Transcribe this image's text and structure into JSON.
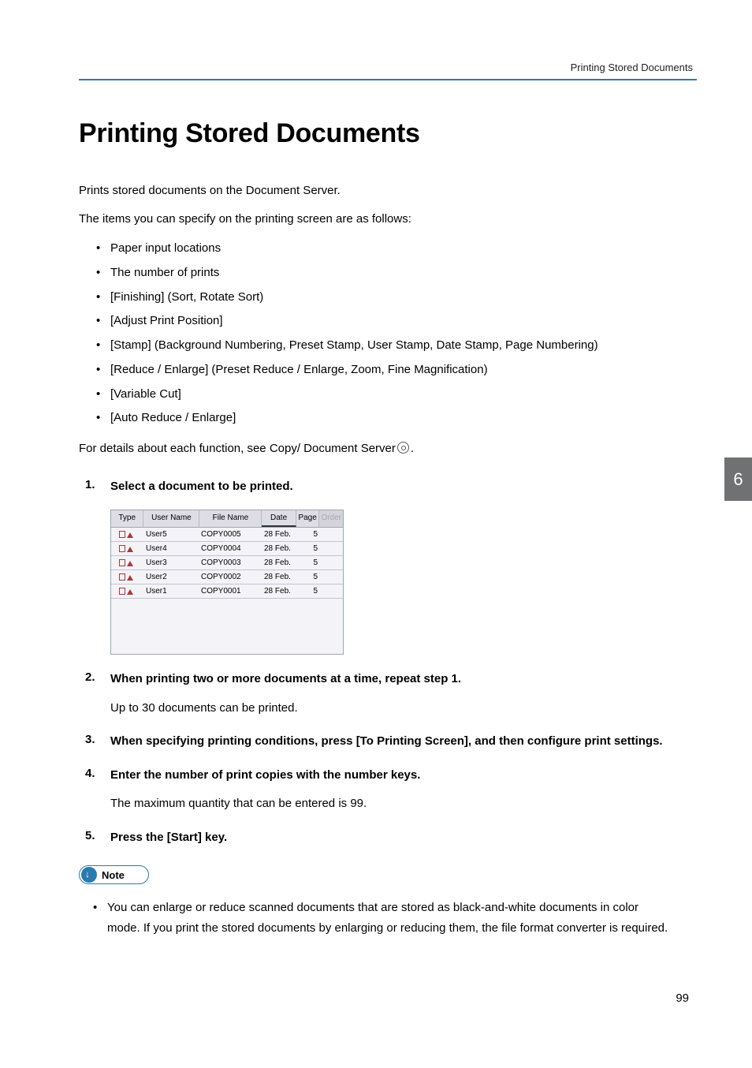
{
  "header": {
    "running_title": "Printing Stored Documents"
  },
  "title": "Printing Stored Documents",
  "intro1": "Prints stored documents on the Document Server.",
  "intro2": "The items you can specify on the printing screen are as follows:",
  "spec_items": [
    "Paper input locations",
    "The number of prints",
    "[Finishing] (Sort, Rotate Sort)",
    "[Adjust Print Position]",
    "[Stamp] (Background Numbering, Preset Stamp, User Stamp, Date Stamp, Page Numbering)",
    "[Reduce / Enlarge] (Preset Reduce / Enlarge, Zoom, Fine Magnification)",
    "[Variable Cut]",
    "[Auto Reduce / Enlarge]"
  ],
  "details_prefix": "For details about each function, see Copy/ Document Server",
  "details_suffix": ".",
  "steps": [
    {
      "head": "Select a document to be printed."
    },
    {
      "head": "When printing two or more documents at a time, repeat step 1.",
      "body": "Up to 30 documents can be printed."
    },
    {
      "head": "When specifying printing conditions, press [To Printing Screen], and then configure print settings."
    },
    {
      "head": "Enter the number of print copies with the number keys.",
      "body": "The maximum quantity that can be entered is 99."
    },
    {
      "head": "Press the [Start] key."
    }
  ],
  "screenshot": {
    "headers": {
      "type": "Type",
      "user": "User Name",
      "file": "File Name",
      "date": "Date",
      "page": "Page",
      "order": "Order"
    },
    "rows": [
      {
        "user": "User5",
        "file": "COPY0005",
        "date": "28 Feb.",
        "page": "5"
      },
      {
        "user": "User4",
        "file": "COPY0004",
        "date": "28 Feb.",
        "page": "5"
      },
      {
        "user": "User3",
        "file": "COPY0003",
        "date": "28 Feb.",
        "page": "5"
      },
      {
        "user": "User2",
        "file": "COPY0002",
        "date": "28 Feb.",
        "page": "5"
      },
      {
        "user": "User1",
        "file": "COPY0001",
        "date": "28 Feb.",
        "page": "5"
      }
    ]
  },
  "note_label": "Note",
  "notes": [
    "You can enlarge or reduce scanned documents that are stored as black-and-white documents in color mode. If you print the stored documents by enlarging or reducing them, the file format converter is required."
  ],
  "chapter_tab": "6",
  "page_number": "99"
}
